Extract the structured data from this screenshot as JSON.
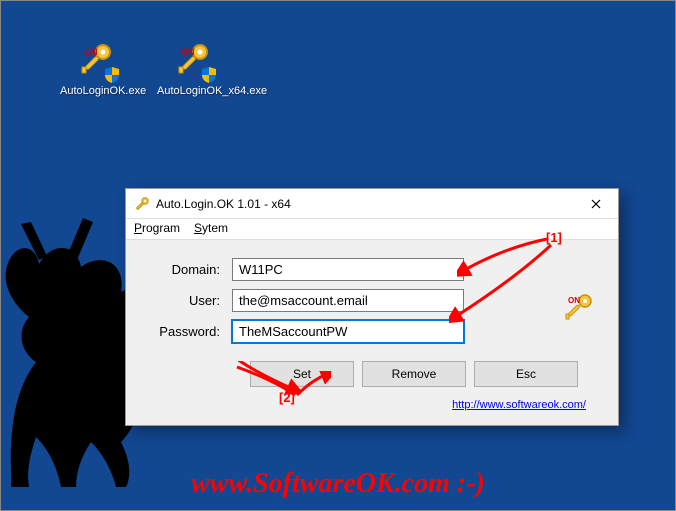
{
  "desktop": {
    "icons": [
      {
        "label": "AutoLoginOK.exe"
      },
      {
        "label": "AutoLoginOK_x64.exe"
      }
    ]
  },
  "window": {
    "title": "Auto.Login.OK 1.01 - x64",
    "menu": {
      "program": "Program",
      "system": "Sytem"
    },
    "fields": {
      "domain_label": "Domain:",
      "user_label": "User:",
      "password_label": "Password:",
      "domain_value": "W11PC",
      "user_value": "the@msaccount.email",
      "password_value": "TheMSaccountPW"
    },
    "buttons": {
      "set": "Set",
      "remove": "Remove",
      "esc": "Esc"
    },
    "link": "http://www.softwareok.com/"
  },
  "annotations": {
    "a1": "[1]",
    "a2": "[2]"
  },
  "watermark": "www.SoftwareOK.com :-)"
}
